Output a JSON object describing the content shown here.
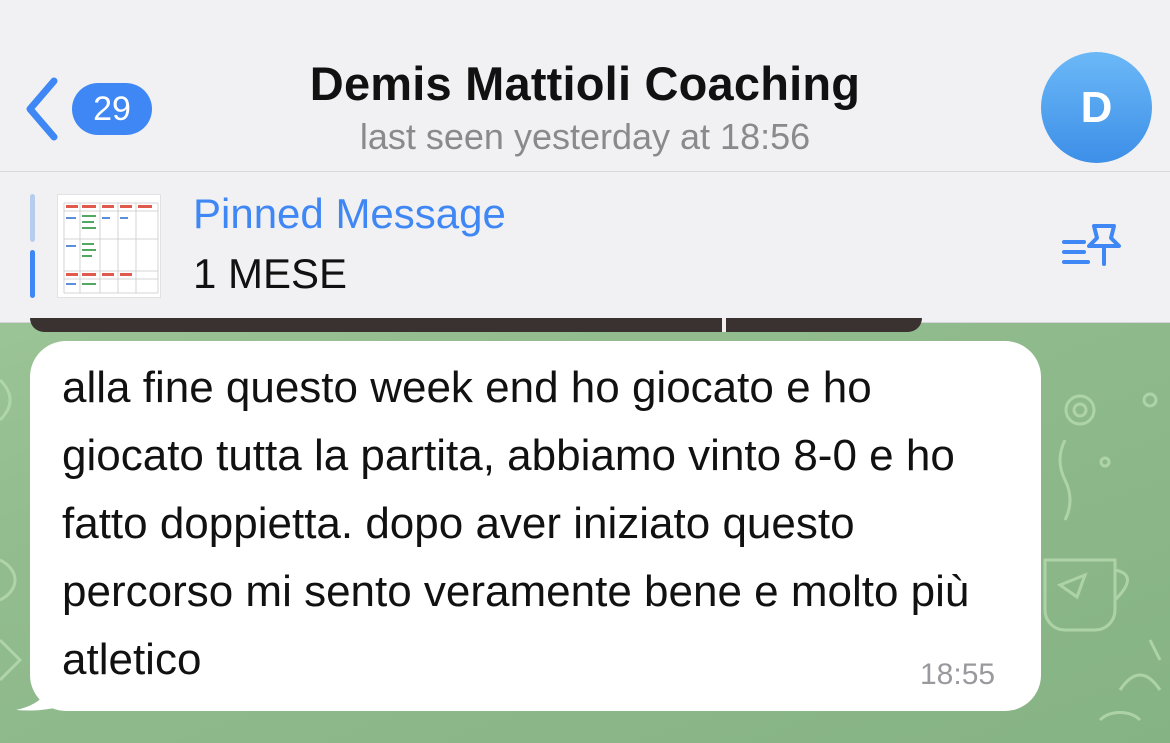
{
  "header": {
    "back_count": "29",
    "title": "Demis Mattioli Coaching",
    "status": "last seen yesterday at 18:56",
    "avatar_initial": "D"
  },
  "pinned": {
    "label": "Pinned Message",
    "text": "1 MESE"
  },
  "message": {
    "text": "alla fine questo week end ho giocato e ho giocato tutta la partita, abbiamo vinto 8-0 e ho fatto doppietta. dopo aver iniziato questo percorso mi sento veramente bene e molto più atletico",
    "time": "18:55"
  },
  "colors": {
    "accent": "#3f87f5",
    "header_bg": "#f1f1f3",
    "wallpaper": "#9cc29a",
    "bubble": "#ffffff"
  },
  "icons": {
    "back": "chevron-left-icon",
    "pins_list": "pinned-list-icon"
  }
}
